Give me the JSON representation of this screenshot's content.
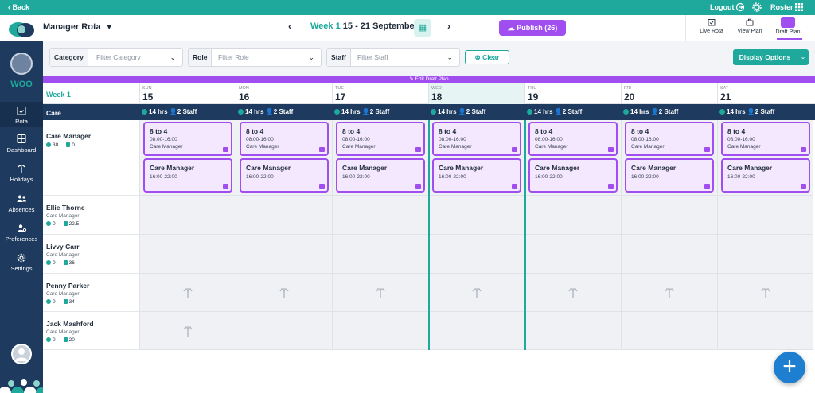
{
  "topbar": {
    "back": "‹ Back",
    "logout": "Logout",
    "roster": "Roster"
  },
  "header": {
    "title": "Manager Rota",
    "week_label": "Week 1",
    "date_range": "15 - 21 September",
    "publish_label": "Publish (26)",
    "views": [
      {
        "label": "Live Rota"
      },
      {
        "label": "View Plan"
      },
      {
        "label": "Draft Plan"
      }
    ]
  },
  "sidebar": {
    "org": "WOO",
    "items": [
      {
        "label": "Rota"
      },
      {
        "label": "Dashboard"
      },
      {
        "label": "Holidays"
      },
      {
        "label": "Absences"
      },
      {
        "label": "Preferences"
      },
      {
        "label": "Settings"
      }
    ]
  },
  "filters": {
    "category": {
      "label": "Category",
      "placeholder": "Filter Category"
    },
    "role": {
      "label": "Role",
      "placeholder": "Filter Role"
    },
    "staff": {
      "label": "Staff",
      "placeholder": "Filter Staff"
    },
    "clear": "Clear",
    "display_options": "Display Options"
  },
  "edit_bar": "Edit Draft Plan",
  "week": {
    "label": "Week 1",
    "days": [
      {
        "name": "SUN",
        "date": "15"
      },
      {
        "name": "MON",
        "date": "16"
      },
      {
        "name": "TUE",
        "date": "17"
      },
      {
        "name": "WED",
        "date": "18"
      },
      {
        "name": "THU",
        "date": "19"
      },
      {
        "name": "FRI",
        "date": "20"
      },
      {
        "name": "SAT",
        "date": "21"
      }
    ]
  },
  "category_row": {
    "label": "Care",
    "hours": "14 hrs",
    "staff": "2 Staff"
  },
  "role_row": {
    "name": "Care Manager",
    "stat_a": "38",
    "stat_b": "0",
    "shift1": {
      "name": "8 to 4",
      "time": "08:00-16:00",
      "role": "Care Manager"
    },
    "shift2": {
      "name": "Care Manager",
      "time": "16:00-22:00"
    }
  },
  "staff": [
    {
      "name": "Ellie Thorne",
      "role": "Care Manager",
      "stat_a": "0",
      "stat_b": "22.5"
    },
    {
      "name": "Livvy Carr",
      "role": "Care Manager",
      "stat_a": "0",
      "stat_b": "36"
    },
    {
      "name": "Penny Parker",
      "role": "Care Manager",
      "stat_a": "0",
      "stat_b": "34"
    },
    {
      "name": "Jack Mashford",
      "role": "Care Manager",
      "stat_a": "0",
      "stat_b": "20"
    }
  ],
  "fab": "+",
  "colors": {
    "teal": "#1fa89c",
    "purple": "#a04ef0",
    "navy": "#1e3a5f",
    "fab": "#1e7fd0"
  }
}
